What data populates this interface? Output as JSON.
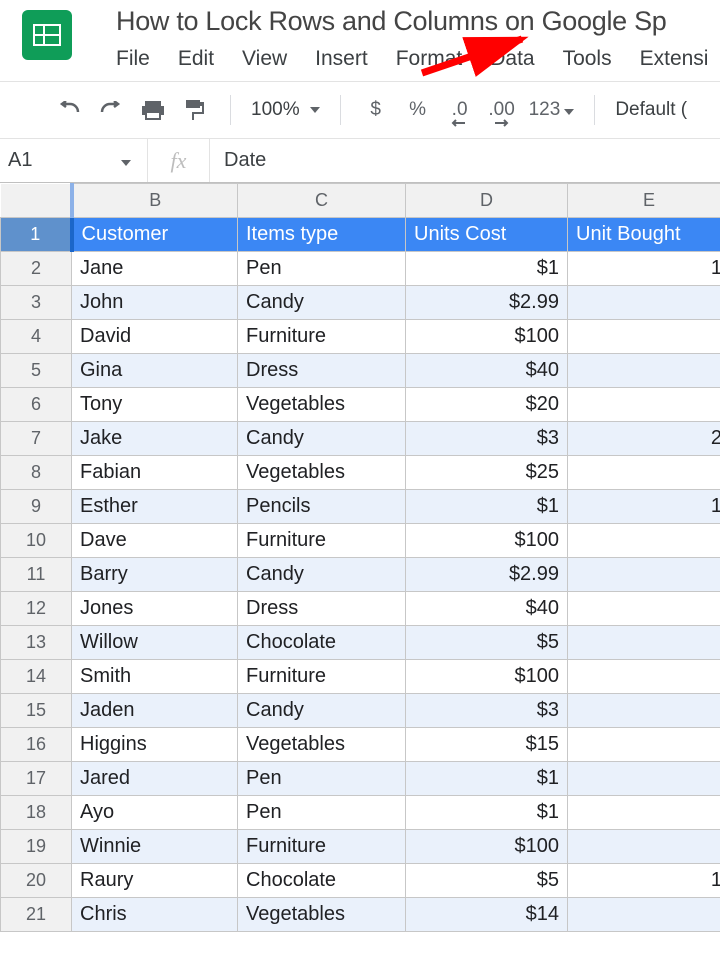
{
  "doc_title": "How to Lock Rows and Columns on Google Sp",
  "menu": [
    "File",
    "Edit",
    "View",
    "Insert",
    "Format",
    "Data",
    "Tools",
    "Extensi"
  ],
  "toolbar": {
    "zoom": "100%",
    "currency": "$",
    "percent": "%",
    "dec_less": ".0",
    "dec_more": ".00",
    "num_fmt": "123",
    "font": "Default ("
  },
  "namebox": "A1",
  "formula": "Date",
  "fx_label": "fx",
  "columns": [
    "B",
    "C",
    "D",
    "E"
  ],
  "headers": {
    "B": "Customer",
    "C": "Items type",
    "D": "Units Cost",
    "E": "Unit Bought"
  },
  "rows": [
    {
      "n": 2,
      "B": "Jane",
      "C": "Pen",
      "D": "$1",
      "E": "1"
    },
    {
      "n": 3,
      "B": "John",
      "C": "Candy",
      "D": "$2.99",
      "E": ""
    },
    {
      "n": 4,
      "B": "David",
      "C": "Furniture",
      "D": "$100",
      "E": ""
    },
    {
      "n": 5,
      "B": "Gina",
      "C": "Dress",
      "D": "$40",
      "E": ""
    },
    {
      "n": 6,
      "B": "Tony",
      "C": "Vegetables",
      "D": "$20",
      "E": ""
    },
    {
      "n": 7,
      "B": "Jake",
      "C": "Candy",
      "D": "$3",
      "E": "2"
    },
    {
      "n": 8,
      "B": "Fabian",
      "C": "Vegetables",
      "D": "$25",
      "E": ""
    },
    {
      "n": 9,
      "B": "Esther",
      "C": "Pencils",
      "D": "$1",
      "E": "1"
    },
    {
      "n": 10,
      "B": "Dave",
      "C": "Furniture",
      "D": "$100",
      "E": ""
    },
    {
      "n": 11,
      "B": "Barry",
      "C": "Candy",
      "D": "$2.99",
      "E": ""
    },
    {
      "n": 12,
      "B": "Jones",
      "C": "Dress",
      "D": "$40",
      "E": ""
    },
    {
      "n": 13,
      "B": "Willow",
      "C": "Chocolate",
      "D": "$5",
      "E": ""
    },
    {
      "n": 14,
      "B": "Smith",
      "C": "Furniture",
      "D": "$100",
      "E": ""
    },
    {
      "n": 15,
      "B": "Jaden",
      "C": "Candy",
      "D": "$3",
      "E": ""
    },
    {
      "n": 16,
      "B": "Higgins",
      "C": "Vegetables",
      "D": "$15",
      "E": ""
    },
    {
      "n": 17,
      "B": "Jared",
      "C": "Pen",
      "D": "$1",
      "E": ""
    },
    {
      "n": 18,
      "B": "Ayo",
      "C": "Pen",
      "D": "$1",
      "E": ""
    },
    {
      "n": 19,
      "B": "Winnie",
      "C": "Furniture",
      "D": "$100",
      "E": ""
    },
    {
      "n": 20,
      "B": "Raury",
      "C": "Chocolate",
      "D": "$5",
      "E": "1"
    },
    {
      "n": 21,
      "B": "Chris",
      "C": "Vegetables",
      "D": "$14",
      "E": ""
    }
  ],
  "chart_data": {
    "type": "table",
    "columns": [
      "Customer",
      "Items type",
      "Units Cost",
      "Unit Bought"
    ],
    "rows": [
      [
        "Jane",
        "Pen",
        1,
        1
      ],
      [
        "John",
        "Candy",
        2.99,
        null
      ],
      [
        "David",
        "Furniture",
        100,
        null
      ],
      [
        "Gina",
        "Dress",
        40,
        null
      ],
      [
        "Tony",
        "Vegetables",
        20,
        null
      ],
      [
        "Jake",
        "Candy",
        3,
        2
      ],
      [
        "Fabian",
        "Vegetables",
        25,
        null
      ],
      [
        "Esther",
        "Pencils",
        1,
        1
      ],
      [
        "Dave",
        "Furniture",
        100,
        null
      ],
      [
        "Barry",
        "Candy",
        2.99,
        null
      ],
      [
        "Jones",
        "Dress",
        40,
        null
      ],
      [
        "Willow",
        "Chocolate",
        5,
        null
      ],
      [
        "Smith",
        "Furniture",
        100,
        null
      ],
      [
        "Jaden",
        "Candy",
        3,
        null
      ],
      [
        "Higgins",
        "Vegetables",
        15,
        null
      ],
      [
        "Jared",
        "Pen",
        1,
        null
      ],
      [
        "Ayo",
        "Pen",
        1,
        null
      ],
      [
        "Winnie",
        "Furniture",
        100,
        null
      ],
      [
        "Raury",
        "Chocolate",
        5,
        1
      ],
      [
        "Chris",
        "Vegetables",
        14,
        null
      ]
    ]
  }
}
